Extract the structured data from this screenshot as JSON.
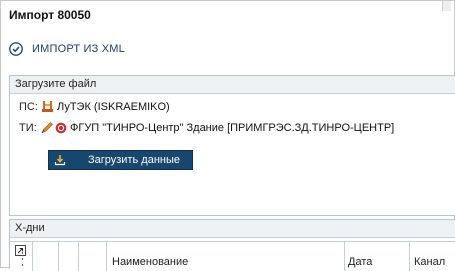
{
  "window": {
    "title": "Импорт 80050"
  },
  "section": {
    "label": "ИМПОРТ ИЗ XML"
  },
  "upload_panel": {
    "header": "Загрузите файл",
    "ps_label": "ПС:",
    "ps_value": "ЛуТЭК (ISKRAEMIKO)",
    "ti_label": "ТИ:",
    "ti_value": "ФГУП \"ТИНРО-Центр\" Здание  [ПРИМГРЭС.ЗД.ТИНРО-ЦЕНТР]",
    "button_label": "Загрузить данные"
  },
  "xdays_panel": {
    "header": "Х-дни",
    "columns": [
      "Наименование",
      "Дата",
      "Канал"
    ]
  },
  "colors": {
    "button_bg": "#17466f",
    "accent_blue": "#1f4f80",
    "panel_header_bg": "#eef1f4"
  },
  "icons": {
    "check": "check-circle-icon",
    "download": "download-icon",
    "substation": "substation-icon",
    "meter_edit": "pencil-icon",
    "meter_status": "error-circle-icon",
    "expand": "expand-arrow-icon"
  }
}
